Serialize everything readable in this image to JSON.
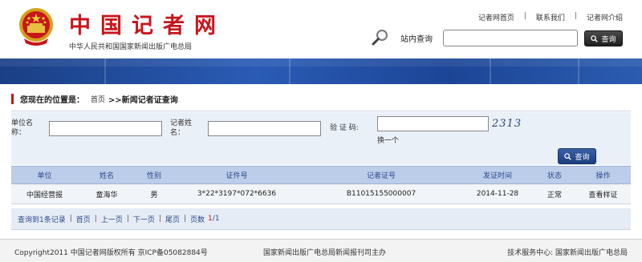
{
  "header": {
    "site_title": "中国记者网",
    "site_subtitle": "中华人民共和国国家新闻出版广电总局",
    "links": [
      "记者网首页",
      "联系我们",
      "记者网介绍"
    ],
    "link_separator": "|",
    "search_label": "站内查询",
    "search_value": "",
    "search_button": "查询"
  },
  "breadcrumb": {
    "label": "您现在的位置是：",
    "home": "首页",
    "current": ">>新闻记者证查询"
  },
  "form": {
    "unit_label": "单位名称：",
    "name_label": "记者姓名：",
    "captcha_label": "验 证 码:",
    "unit_value": "",
    "name_value": "",
    "captcha_value": "",
    "captcha_text": "2313",
    "refresh_label": "换一个",
    "submit_button": "查询"
  },
  "table": {
    "headers": [
      "单位",
      "姓名",
      "性别",
      "证件号",
      "记者证号",
      "发证时间",
      "状态",
      "操作"
    ],
    "rows": [
      [
        "中国经营报",
        "童海华",
        "男",
        "3*22*3197*072*6636",
        "B11015155000007",
        "2014-11-28",
        "正常",
        "查看样证"
      ]
    ]
  },
  "pager": {
    "summary": "查询到1条记录",
    "first": "首页",
    "prev": "上一页",
    "next": "下一页",
    "last": "尾页",
    "pages_label": "页数",
    "current_page": "1",
    "total_pages": "/1",
    "separator": "|"
  },
  "footer": {
    "left": "Copyright2011   中国记者网版权所有   京ICP备05082884号",
    "center": "国家新闻出版广电总局新闻报刊司主办",
    "right": "技术服务中心:   国家新闻出版广电总局"
  },
  "colors": {
    "brand_red": "#c8161d",
    "banner_blue": "#2a5bb5",
    "table_header": "#bccdea"
  },
  "icons": [
    "national-emblem-icon",
    "magnifier-icon",
    "search-icon"
  ]
}
